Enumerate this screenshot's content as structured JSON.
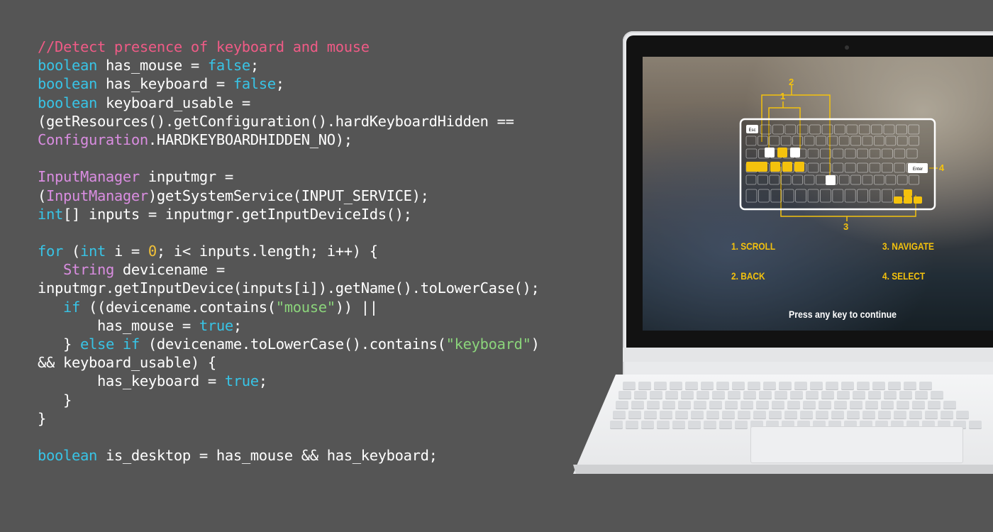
{
  "code": {
    "lines": [
      [
        {
          "t": "//Detect presence of keyboard and mouse",
          "c": "comment"
        }
      ],
      [
        {
          "t": "boolean",
          "c": "type"
        },
        {
          "t": " has_mouse = "
        },
        {
          "t": "false",
          "c": "bool"
        },
        {
          "t": ";"
        }
      ],
      [
        {
          "t": "boolean",
          "c": "type"
        },
        {
          "t": " has_keyboard = "
        },
        {
          "t": "false",
          "c": "bool"
        },
        {
          "t": ";"
        }
      ],
      [
        {
          "t": "boolean",
          "c": "type"
        },
        {
          "t": " keyboard_usable ="
        }
      ],
      [
        {
          "t": "(getResources().getConfiguration().hardKeyboardHidden =="
        }
      ],
      [
        {
          "t": "Configuration",
          "c": "class"
        },
        {
          "t": ".HARDKEYBOARDHIDDEN_NO);"
        }
      ],
      [
        {
          "t": ""
        }
      ],
      [
        {
          "t": "InputManager",
          "c": "class"
        },
        {
          "t": " inputmgr ="
        }
      ],
      [
        {
          "t": "("
        },
        {
          "t": "InputManager",
          "c": "class"
        },
        {
          "t": ")getSystemService(INPUT_SERVICE);"
        }
      ],
      [
        {
          "t": "int",
          "c": "type"
        },
        {
          "t": "[] inputs = inputmgr.getInputDeviceIds();"
        }
      ],
      [
        {
          "t": ""
        }
      ],
      [
        {
          "t": "for",
          "c": "keyword"
        },
        {
          "t": " ("
        },
        {
          "t": "int",
          "c": "type"
        },
        {
          "t": " i = "
        },
        {
          "t": "0",
          "c": "num"
        },
        {
          "t": "; i< inputs.length; i++) {"
        }
      ],
      [
        {
          "t": "   "
        },
        {
          "t": "String",
          "c": "class"
        },
        {
          "t": " devicename ="
        }
      ],
      [
        {
          "t": "inputmgr.getInputDevice(inputs[i]).getName().toLowerCase();"
        }
      ],
      [
        {
          "t": "   "
        },
        {
          "t": "if",
          "c": "keyword"
        },
        {
          "t": " ((devicename.contains("
        },
        {
          "t": "\"mouse\"",
          "c": "string"
        },
        {
          "t": ")) ||"
        }
      ],
      [
        {
          "t": "       has_mouse = "
        },
        {
          "t": "true",
          "c": "bool"
        },
        {
          "t": ";"
        }
      ],
      [
        {
          "t": "   } "
        },
        {
          "t": "else if",
          "c": "keyword"
        },
        {
          "t": " (devicename.toLowerCase().contains("
        },
        {
          "t": "\"keyboard\"",
          "c": "string"
        },
        {
          "t": ")"
        }
      ],
      [
        {
          "t": "&& keyboard_usable) {"
        }
      ],
      [
        {
          "t": "       has_keyboard = "
        },
        {
          "t": "true",
          "c": "bool"
        },
        {
          "t": ";"
        }
      ],
      [
        {
          "t": "   }"
        }
      ],
      [
        {
          "t": "}"
        }
      ],
      [
        {
          "t": ""
        }
      ],
      [
        {
          "t": "boolean",
          "c": "type"
        },
        {
          "t": " is_desktop = has_mouse && has_keyboard;"
        }
      ]
    ]
  },
  "game_screen": {
    "callouts": [
      "1",
      "2",
      "3",
      "4"
    ],
    "key_labels": {
      "esc": "Esc",
      "enter": "Enter"
    },
    "hints": {
      "scroll": "1. SCROLL",
      "navigate": "3. NAVIGATE",
      "back": "2. BACK",
      "select": "4. SELECT"
    },
    "prompt": "Press any key to continue"
  },
  "colors": {
    "background": "#555555",
    "comment": "#ef5b86",
    "type": "#38c4e6",
    "class": "#d98de0",
    "string": "#8bd47b",
    "number": "#f3c238",
    "highlight": "#f4c20d"
  }
}
